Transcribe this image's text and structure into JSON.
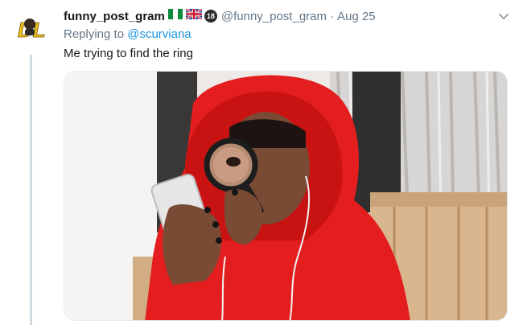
{
  "tweet": {
    "display_name": "funny_post_gram",
    "handle": "@funny_post_gram",
    "separator": "·",
    "date": "Aug 25",
    "badge": "18",
    "reply_prefix": "Replying to",
    "reply_user": "@scurviana",
    "text": "Me trying to find the ring",
    "avatar_text": "DL",
    "flags": [
      "nigeria-flag",
      "uk-flag"
    ]
  },
  "icons": {
    "menu": "chevron-down-icon"
  },
  "colors": {
    "name": "#14171a",
    "secondary": "#657786",
    "link": "#1b95e0",
    "hoodie": "#e41e1e"
  }
}
